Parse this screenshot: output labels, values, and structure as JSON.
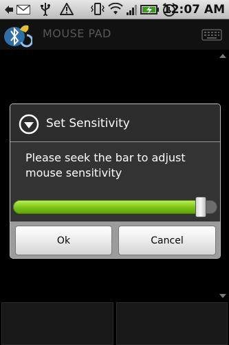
{
  "status_bar": {
    "time": "12:07",
    "ampm": "AM",
    "icons": [
      "back-icon",
      "gmail-icon",
      "usb-icon",
      "warning-icon",
      "vibrate-icon",
      "wifi-icon",
      "signal-icon",
      "battery-charging-icon",
      "alarm-icon"
    ]
  },
  "app": {
    "title": "MOUSE PAD"
  },
  "dialog": {
    "title": "Set Sensitivity",
    "message": "Please seek the bar to adjust mouse sensitivity",
    "seekbar_value_percent": 92,
    "ok_label": "Ok",
    "cancel_label": "Cancel"
  },
  "colors": {
    "seek_fill": "#7cc317",
    "status_bar": "#d0d0d0",
    "dialog_bg": "#333333"
  }
}
